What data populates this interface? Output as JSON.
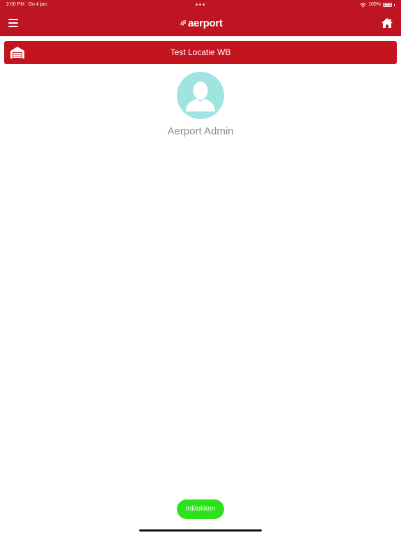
{
  "status_bar": {
    "time": "2:00 PM",
    "date": "Do 4 jan.",
    "battery": "100%"
  },
  "header": {
    "logo_text": "aerport",
    "menu_icon": "hamburger-menu-icon",
    "home_icon": "home-icon"
  },
  "location": {
    "name": "Test Locatie WB",
    "icon": "warehouse-icon"
  },
  "user": {
    "name": "Aerport Admin",
    "avatar_icon": "user-silhouette-icon"
  },
  "actions": {
    "checkin_label": "Inklokken"
  },
  "colors": {
    "brand_red": "#bd1622",
    "avatar_bg": "#9fe4e0",
    "checkin_green": "#2ee21b",
    "username_gray": "#8c8c8c"
  }
}
